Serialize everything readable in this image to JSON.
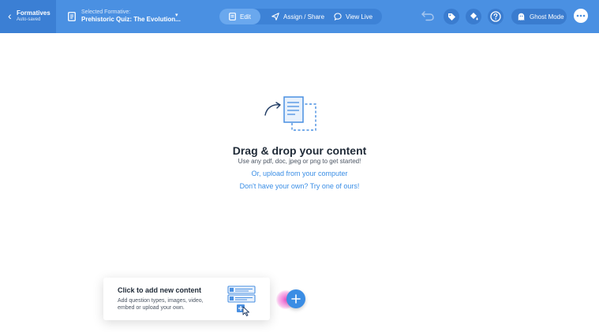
{
  "header": {
    "back_title": "Formatives",
    "back_status": "Auto-saved",
    "selected_label": "Selected Formative:",
    "selected_title": "Prehistoric Quiz: The Evolution...",
    "modes": [
      {
        "label": "Edit",
        "icon": "edit-icon",
        "active": true
      },
      {
        "label": "Assign / Share",
        "icon": "send-icon",
        "active": false
      },
      {
        "label": "View Live",
        "icon": "chat-icon",
        "active": false
      }
    ],
    "ghost_mode_label": "Ghost Mode"
  },
  "main": {
    "headline": "Drag & drop your content",
    "hint": "Use any pdf, doc, jpeg or png to get started!",
    "upload_link": "Or, upload from your computer",
    "try_link": "Don't have your own? Try one of ours!"
  },
  "tooltip": {
    "title": "Click to add new content",
    "body": "Add question types, images, video, embed or upload your own."
  },
  "colors": {
    "topbar": "#4a90e2",
    "accent": "#3a8ee6",
    "glow": "#ec48c8"
  }
}
